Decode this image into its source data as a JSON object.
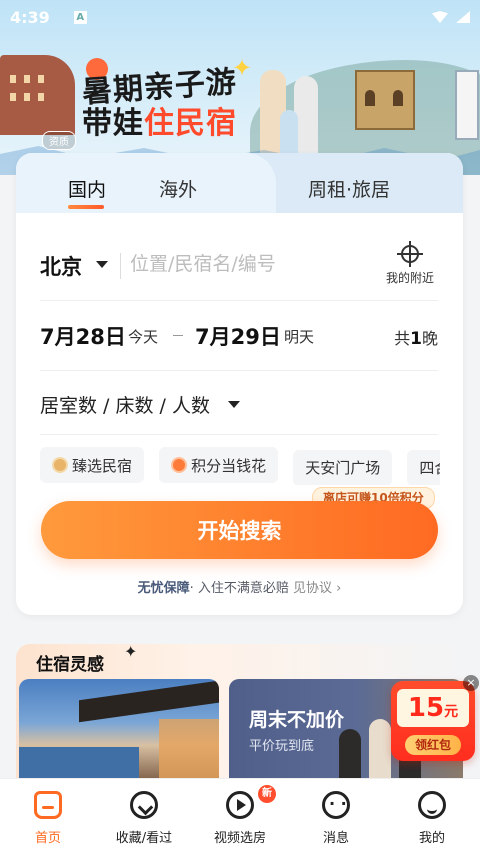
{
  "status_bar": {
    "time": "4:39",
    "app_icon": "A"
  },
  "hero": {
    "title_line1": "暑期亲子游",
    "title_line2_a": "带娃",
    "title_line2_b": "住民宿",
    "badge": "资质"
  },
  "tabs": [
    {
      "label": "国内",
      "active": true
    },
    {
      "label": "海外",
      "active": false
    },
    {
      "label": "周租·旅居",
      "active": false
    }
  ],
  "search": {
    "city": "北京",
    "placeholder": "位置/民宿名/编号",
    "nearby_label": "我的附近",
    "checkin_date": "7月28日",
    "checkin_sub": "今天",
    "checkout_date": "7月29日",
    "checkout_sub": "明天",
    "nights_prefix": "共",
    "nights_num": "1",
    "nights_suffix": "晚",
    "room_selector": "居室数 / 床数 / 人数",
    "chips": [
      {
        "label": "臻选民宿",
        "icon": "gold-house-icon"
      },
      {
        "label": "积分当钱花",
        "icon": "coin-icon"
      },
      {
        "label": "天安门广场",
        "icon": ""
      },
      {
        "label": "四合",
        "icon": ""
      }
    ],
    "points_tag": "离店可赚10倍积分",
    "button": "开始搜索",
    "guarantee_title": "无忧保障",
    "guarantee_text": "· 入住不满意必赔",
    "guarantee_more": "见协议 ›"
  },
  "inspiration": {
    "title": "住宿灵感",
    "card2_title": "周末不加价",
    "card2_sub": "平价玩到底"
  },
  "red_packet": {
    "amount": "15",
    "unit": "元",
    "label": "领红包"
  },
  "nav": [
    {
      "label": "首页",
      "icon": "home-icon",
      "active": true
    },
    {
      "label": "收藏/看过",
      "icon": "heart-icon",
      "active": false
    },
    {
      "label": "视频选房",
      "icon": "video-icon",
      "active": false,
      "badge": "新"
    },
    {
      "label": "消息",
      "icon": "message-icon",
      "active": false
    },
    {
      "label": "我的",
      "icon": "profile-icon",
      "active": false
    }
  ],
  "colors": {
    "accent": "#ff6a22",
    "accent_light": "#ff9a3c",
    "tab_bg": "#dbeaf6"
  }
}
